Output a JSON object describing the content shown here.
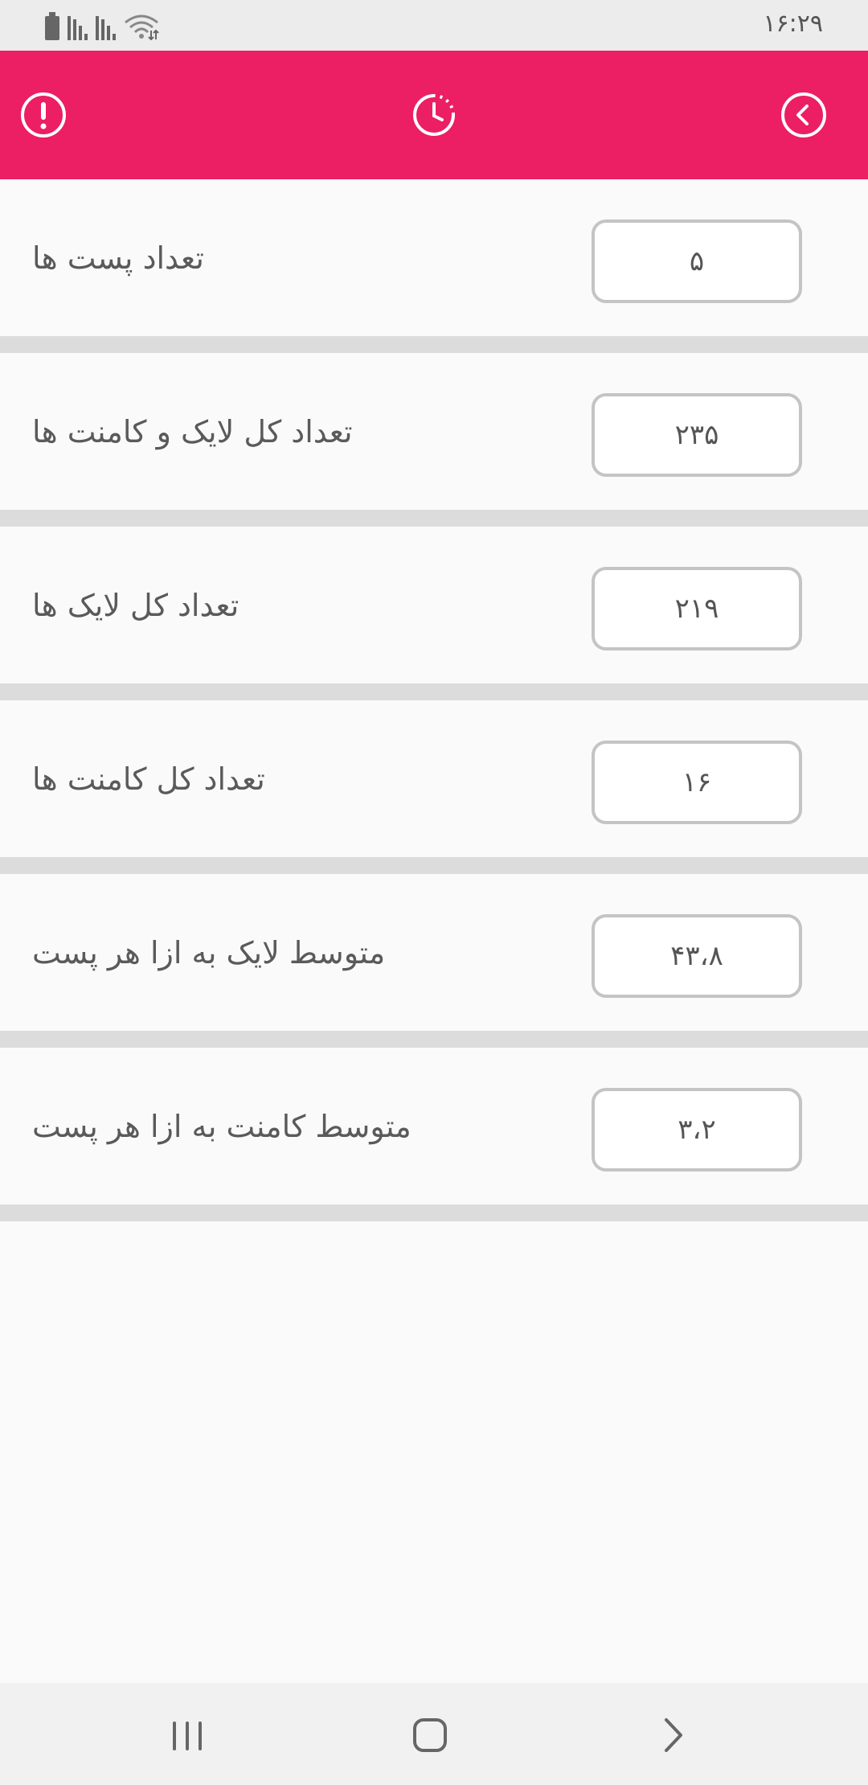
{
  "status_bar": {
    "time": "۱۶:۲۹"
  },
  "app_bar": {
    "background": "#ec1e64",
    "icons": [
      "info-icon",
      "history-icon",
      "back-icon"
    ]
  },
  "stats": [
    {
      "label": "تعداد پست ها",
      "value": "۵"
    },
    {
      "label": "تعداد کل لایک و کامنت ها",
      "value": "۲۳۵"
    },
    {
      "label": "تعداد کل لایک ها",
      "value": "۲۱۹"
    },
    {
      "label": "تعداد کل کامنت ها",
      "value": "۱۶"
    },
    {
      "label": "متوسط لایک به ازا هر پست",
      "value": "۴۳،۸"
    },
    {
      "label": "متوسط کامنت به ازا هر پست",
      "value": "۳،۲"
    }
  ],
  "nav_bar": {
    "icons": [
      "recent-apps-icon",
      "home-icon",
      "back-nav-icon"
    ]
  }
}
